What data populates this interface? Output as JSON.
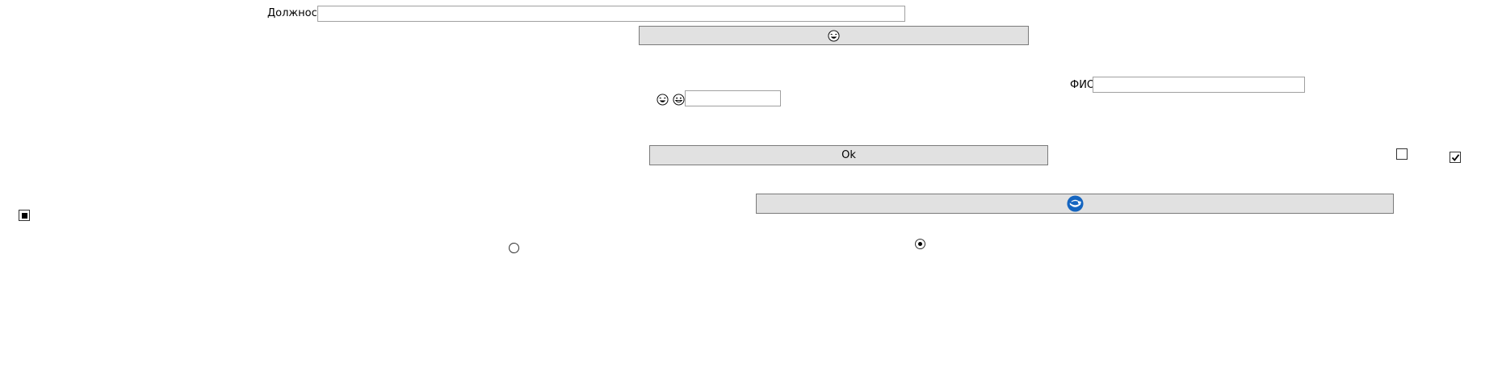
{
  "form": {
    "position_label": "Должность",
    "position_value": "",
    "fio_label": "ФИО",
    "fio_value": "",
    "small_value": "",
    "ok_label": "Ok"
  },
  "icons": {
    "top_button": "laughing-face-icon",
    "smile_one": "laughing-face-icon",
    "smile_two": "grinning-face-icon",
    "wide_button": "blue-circular-logo-icon"
  },
  "checkboxes": {
    "top_right_a": "unchecked",
    "top_right_b": "checked",
    "left": "indeterminate"
  },
  "radios": {
    "left": "unselected",
    "right": "selected"
  },
  "colors": {
    "button_face": "#e1e1e1",
    "logo_blue": "#1565c0"
  }
}
